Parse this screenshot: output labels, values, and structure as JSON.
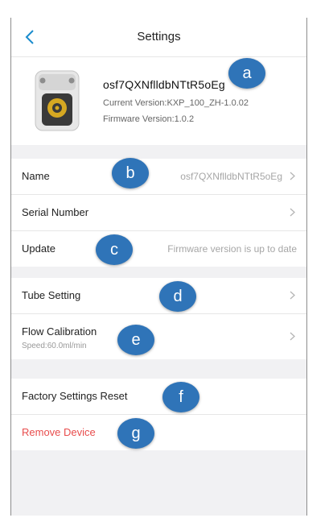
{
  "nav": {
    "title": "Settings"
  },
  "device": {
    "name": "osf7QXNflldbNTtR5oEg",
    "current_version": "Current Version:KXP_100_ZH-1.0.02",
    "firmware_version": "Firmware Version:1.0.2"
  },
  "settings": {
    "name_label": "Name",
    "name_value": "osf7QXNflldbNTtR5oEg",
    "serial_label": "Serial Number",
    "update_label": "Update",
    "update_value": "Firmware version is up to date",
    "tube_label": "Tube Setting",
    "flow_label": "Flow Calibration",
    "flow_sub": "Speed:60.0ml/min",
    "reset_label": "Factory Settings Reset",
    "remove_label": "Remove Device"
  },
  "markers": [
    "a",
    "b",
    "c",
    "d",
    "e",
    "f",
    "g"
  ],
  "colors": {
    "accent": "#1a8ccd",
    "marker": "#2f74b8",
    "danger": "#e84d4d",
    "background": "#f1f1f3"
  }
}
